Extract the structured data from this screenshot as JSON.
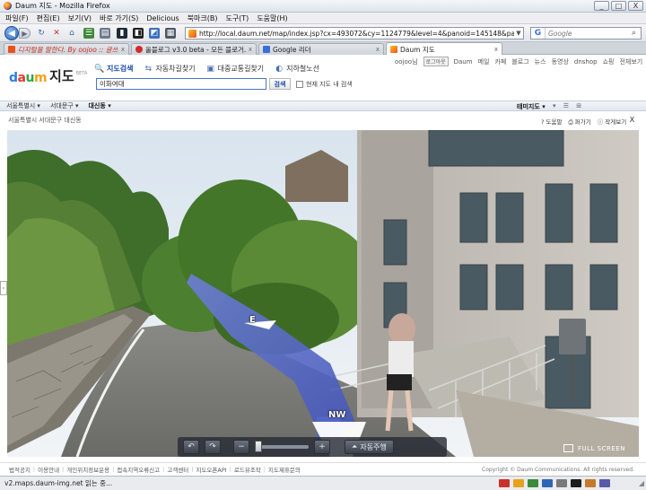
{
  "window": {
    "title": "Daum 지도 - Mozilla Firefox",
    "minimize": "_",
    "maximize": "□",
    "close": "X"
  },
  "menu": [
    "파일(F)",
    "편집(E)",
    "보기(V)",
    "바로 가기(S)",
    "Delicious",
    "북마크(B)",
    "도구(T)",
    "도움말(H)"
  ],
  "toolbar": {
    "url": "http://local.daum.net/map/index.jsp?cx=493072&cy=1124779&level=4&panoid=145148&pan=14.591384415774",
    "search_engine": "G",
    "search_placeholder": "Google"
  },
  "tabs": [
    {
      "label": "디지털을 말한다. By oojoo :: 글쓰기",
      "color": "#e8531b",
      "close": "x"
    },
    {
      "label": "올블로그 v3.0 beta - 모든 블로거...",
      "color": "#d42b2b",
      "close": "x"
    },
    {
      "label": "Google 리더",
      "color": "#3a6fd8",
      "close": "x"
    },
    {
      "label": "Daum 지도",
      "color": "#2a7de1",
      "close": "x"
    }
  ],
  "site": {
    "logo": {
      "d": "d",
      "a": "a",
      "u": "u",
      "m": "m",
      "jido": "지도",
      "beta": "BETA"
    },
    "search_tabs": [
      {
        "label": "지도검색",
        "icon": "🔍",
        "active": true
      },
      {
        "label": "자동차길찾기",
        "icon": "⇆",
        "active": false
      },
      {
        "label": "대중교통길찾기",
        "icon": "▣",
        "active": false
      },
      {
        "label": "지하철노선",
        "icon": "◐",
        "active": false
      }
    ],
    "query": "이화여대",
    "search_button": "검색",
    "within_map": "현재 지도 내 검색",
    "user": "oojoo님",
    "logout": "로그아웃",
    "top_links": [
      "Daum",
      "메일",
      "카페",
      "블로그",
      "뉴스",
      "동영상",
      "dnshop",
      "쇼핑",
      "전체보기"
    ]
  },
  "location_bar": {
    "city": "서울특별시",
    "district": "서대문구",
    "dong": "대신동",
    "map_select": "테미지도",
    "icons": "▾ ☰ ⊞"
  },
  "info": {
    "address": "서울특별시 서대문구 대신동",
    "actions": [
      "? 도움말",
      "⎙ 퍼가기",
      "ⓘ 작게보기"
    ],
    "close": "X"
  },
  "streetview": {
    "dir_east": "E",
    "dir_nw": "NW",
    "side_handle": "›",
    "controls": {
      "rot_left": "↶",
      "rot_right": "↷",
      "zoom_out": "−",
      "zoom_in": "+",
      "autodrive": "자동주행",
      "autodrive_icon": "⏶",
      "zoom_level": 0.0
    },
    "full_screen": "FULL SCREEN"
  },
  "footer": {
    "links": [
      "법적공지",
      "이용안내",
      "개인위치정보운용",
      "접속지역오류신고",
      "고객센터",
      "지도오픈API",
      "로드뷰조작",
      "지도제휴문의"
    ],
    "copyright": "Copyright © Daum Communications. All rights reserved."
  },
  "status": {
    "text": "v2.maps.daum-img.net 읽는 중..."
  }
}
